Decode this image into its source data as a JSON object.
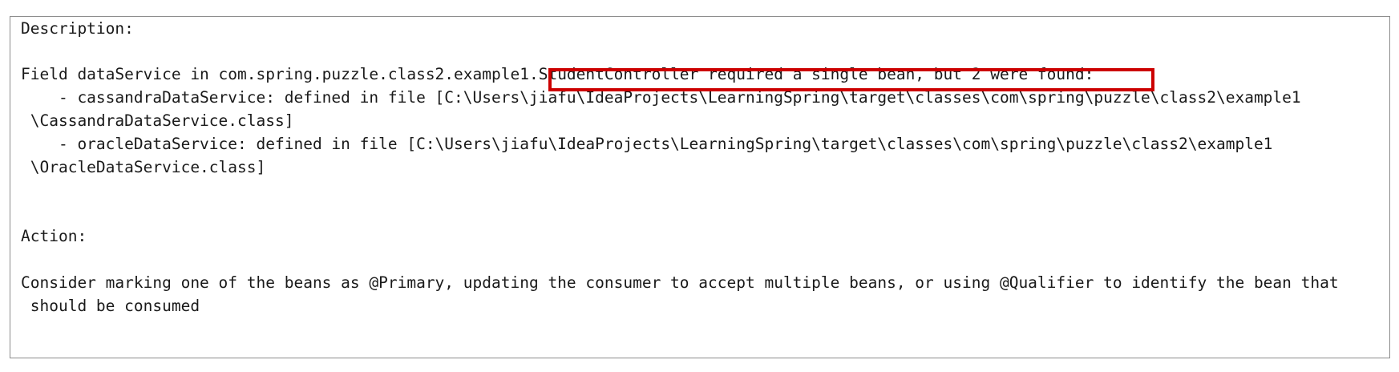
{
  "console": {
    "description_label": "Description:",
    "field_line_prefix": "Field dataService in com.spring.puzzle.class2.example1",
    "field_line_highlight": ".StudentController required a single bean, but 2 were found:",
    "bean1_line1": "    - cassandraDataService: defined in file [C:\\Users\\jiafu\\IdeaProjects\\LearningSpring\\target\\classes\\com\\spring\\puzzle\\class2\\example1",
    "bean1_line2": " \\CassandraDataService.class]",
    "bean2_line1": "    - oracleDataService: defined in file [C:\\Users\\jiafu\\IdeaProjects\\LearningSpring\\target\\classes\\com\\spring\\puzzle\\class2\\example1",
    "bean2_line2": " \\OracleDataService.class]",
    "action_label": "Action:",
    "consider_line1": "Consider marking one of the beans as @Primary, updating the consumer to accept multiple beans, or using @Qualifier to identify the bean that",
    "consider_line2": " should be consumed"
  },
  "colors": {
    "highlight_border": "#cc0000",
    "panel_border": "#8c8c8c",
    "text": "#1a1a1a"
  }
}
